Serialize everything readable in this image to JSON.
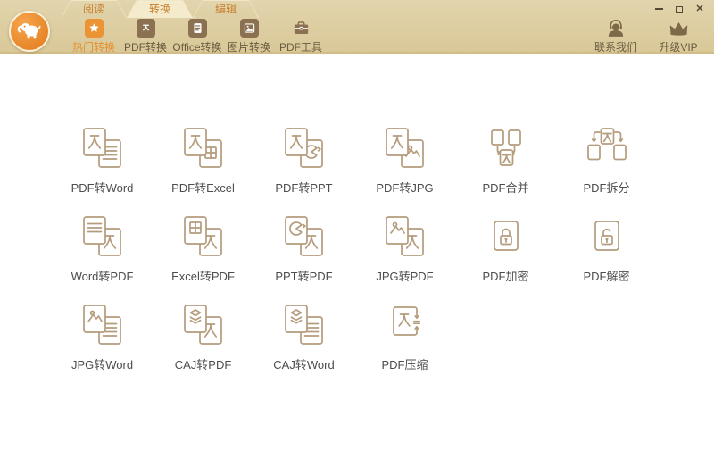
{
  "tabs": [
    {
      "id": "read",
      "label": "阅读",
      "active": false
    },
    {
      "id": "convert",
      "label": "转换",
      "active": true
    },
    {
      "id": "edit",
      "label": "编辑",
      "active": false
    }
  ],
  "toolbar": {
    "items": [
      {
        "id": "hot-convert",
        "label": "热门转换",
        "icon": "star",
        "active": true
      },
      {
        "id": "pdf-convert",
        "label": "PDF转换",
        "icon": "pdf",
        "active": false
      },
      {
        "id": "office-convert",
        "label": "Office转换",
        "icon": "doc",
        "active": false
      },
      {
        "id": "image-convert",
        "label": "图片转换",
        "icon": "image",
        "active": false
      },
      {
        "id": "pdf-tools",
        "label": "PDF工具",
        "icon": "toolbox",
        "active": false
      }
    ]
  },
  "header_right": [
    {
      "id": "contact-us",
      "label": "联系我们",
      "icon": "headset"
    },
    {
      "id": "upgrade-vip",
      "label": "升级VIP",
      "icon": "crown"
    }
  ],
  "window_controls": [
    {
      "id": "minimize",
      "icon": "minimize-icon"
    },
    {
      "id": "maximize",
      "icon": "maximize-icon"
    },
    {
      "id": "close",
      "icon": "close-icon"
    }
  ],
  "logo_icon": "elephant-mascot",
  "grid_items": [
    {
      "id": "pdf-to-word",
      "label": "PDF转Word",
      "icon": "pdf-to-word"
    },
    {
      "id": "pdf-to-excel",
      "label": "PDF转Excel",
      "icon": "pdf-to-excel"
    },
    {
      "id": "pdf-to-ppt",
      "label": "PDF转PPT",
      "icon": "pdf-to-ppt"
    },
    {
      "id": "pdf-to-jpg",
      "label": "PDF转JPG",
      "icon": "pdf-to-jpg"
    },
    {
      "id": "pdf-merge",
      "label": "PDF合并",
      "icon": "pdf-merge"
    },
    {
      "id": "pdf-split",
      "label": "PDF拆分",
      "icon": "pdf-split"
    },
    {
      "id": "word-to-pdf",
      "label": "Word转PDF",
      "icon": "word-to-pdf"
    },
    {
      "id": "excel-to-pdf",
      "label": "Excel转PDF",
      "icon": "excel-to-pdf"
    },
    {
      "id": "ppt-to-pdf",
      "label": "PPT转PDF",
      "icon": "ppt-to-pdf"
    },
    {
      "id": "jpg-to-pdf",
      "label": "JPG转PDF",
      "icon": "jpg-to-pdf"
    },
    {
      "id": "pdf-encrypt",
      "label": "PDF加密",
      "icon": "lock"
    },
    {
      "id": "pdf-decrypt",
      "label": "PDF解密",
      "icon": "unlock"
    },
    {
      "id": "jpg-to-word",
      "label": "JPG转Word",
      "icon": "jpg-to-word"
    },
    {
      "id": "caj-to-pdf",
      "label": "CAJ转PDF",
      "icon": "caj-to-pdf"
    },
    {
      "id": "caj-to-word",
      "label": "CAJ转Word",
      "icon": "caj-to-word"
    },
    {
      "id": "pdf-compress",
      "label": "PDF压缩",
      "icon": "pdf-compress"
    }
  ],
  "colors": {
    "header_top": "#e2d4ad",
    "header_bottom": "#d9c898",
    "header_border": "#d2bc88",
    "accent_orange": "#ec9334",
    "toolbar_icon_brown": "#8b7152",
    "tab_text": "#c8802f",
    "outline_tan": "#b49c7d",
    "grid_label": "#4d4d4d",
    "logo_orange": "#e2791b"
  }
}
